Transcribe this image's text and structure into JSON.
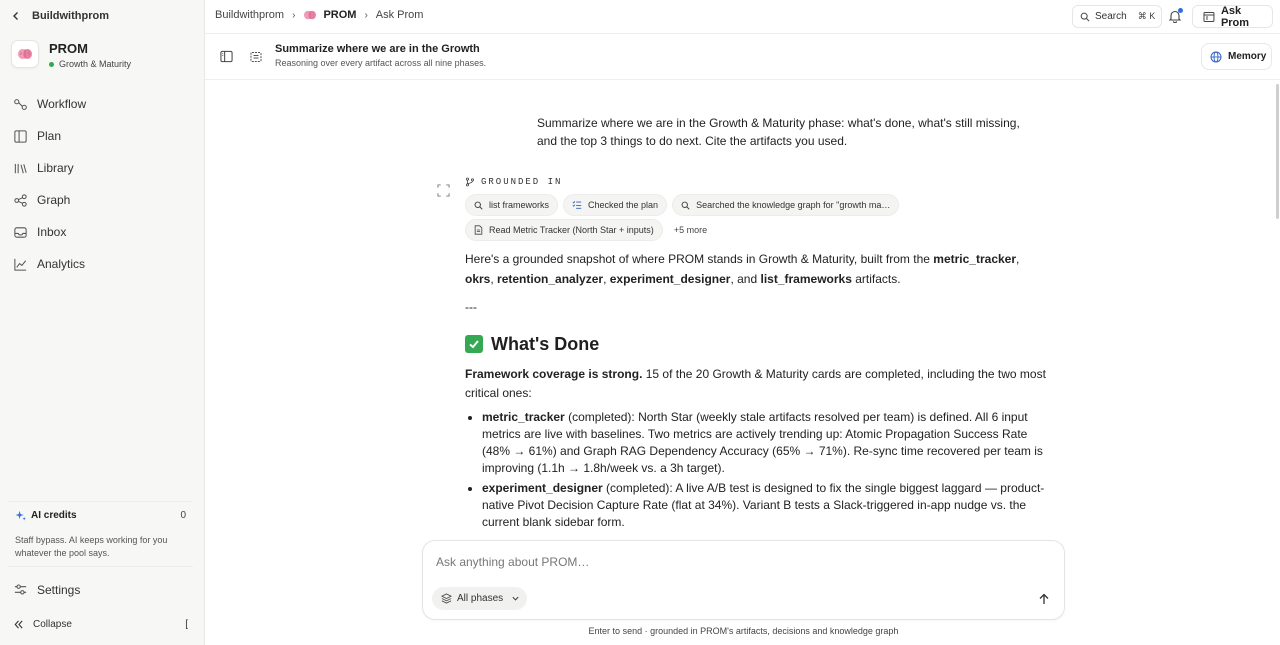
{
  "sidebar": {
    "workspace": "Buildwithprom",
    "project": {
      "name": "PROM",
      "phase": "Growth & Maturity",
      "status_color": "#2fa84f"
    },
    "nav": [
      {
        "label": "Workflow",
        "icon": "workflow-icon"
      },
      {
        "label": "Plan",
        "icon": "plan-icon"
      },
      {
        "label": "Library",
        "icon": "library-icon"
      },
      {
        "label": "Graph",
        "icon": "graph-icon"
      },
      {
        "label": "Inbox",
        "icon": "inbox-icon"
      },
      {
        "label": "Analytics",
        "icon": "analytics-icon"
      }
    ],
    "credits": {
      "title": "AI credits",
      "count": "0",
      "note": "Staff bypass. AI keeps working for you whatever the pool says."
    },
    "settings_label": "Settings",
    "collapse_label": "Collapse",
    "collapse_shortcut": "["
  },
  "topbar": {
    "breadcrumbs": [
      "Buildwithprom",
      "PROM",
      "Ask Prom"
    ],
    "search_label": "Search",
    "search_shortcut": "⌘ K",
    "ask_button": "Ask Prom",
    "notification_badge_color": "#2f6fe0"
  },
  "chat": {
    "title": "Summarize where we are in the Growth",
    "subtitle": "Reasoning over every artifact across all nine phases.",
    "memory_button": "Memory",
    "user_message": "Summarize where we are in the Growth & Maturity phase: what's done, what's still missing, and the top 3 things to do next. Cite the artifacts you used.",
    "grounded_label": "GROUNDED IN",
    "chips_row1": [
      {
        "label": "list frameworks",
        "icon": "search-icon"
      },
      {
        "label": "Checked the plan",
        "icon": "checklist-icon"
      },
      {
        "label": "Searched the knowledge graph for \"growth ma…",
        "icon": "search-icon"
      }
    ],
    "chips_row2": [
      {
        "label": "Read Metric Tracker (North Star + inputs)",
        "icon": "document-icon"
      }
    ],
    "more_label": "+5 more",
    "answer": {
      "intro_pre": "Here's a grounded snapshot of where PROM stands in Growth & Maturity, built from the ",
      "a1": "metric_tracker",
      "c1": ", ",
      "a2": "okrs",
      "c2": ", ",
      "a3": "retention_analyzer",
      "c3": ", ",
      "a4": "experiment_designer",
      "c4": ", and ",
      "a5": "list_frameworks",
      "intro_post": " artifacts.",
      "divider": "---",
      "done_heading": "What's Done",
      "coverage_bold": "Framework coverage is strong.",
      "coverage_text": " 15 of the 20 Growth & Maturity cards are completed, including the two most critical ones:",
      "items": [
        {
          "name": "metric_tracker",
          "text": " (completed): North Star (weekly stale artifacts resolved per team) is defined. All 6 input metrics are live with baselines. Two metrics are actively trending up: Atomic Propagation Success Rate (48% → 61%) and Graph RAG Dependency Accuracy (65% → 71%). Re-sync time recovered per team is improving (1.1h → 1.8h/week vs. a 3h target)."
        },
        {
          "name": "experiment_designer",
          "text": " (completed): A live A/B test is designed to fix the single biggest laggard — product-native Pivot Decision Capture Rate (flat at 34%). Variant B tests a Slack-triggered in-app nudge vs. the current blank sidebar form."
        }
      ]
    }
  },
  "composer": {
    "placeholder": "Ask anything about PROM…",
    "phase_select": "All phases",
    "hint": "Enter to send · grounded in PROM's artifacts, decisions and knowledge graph"
  }
}
